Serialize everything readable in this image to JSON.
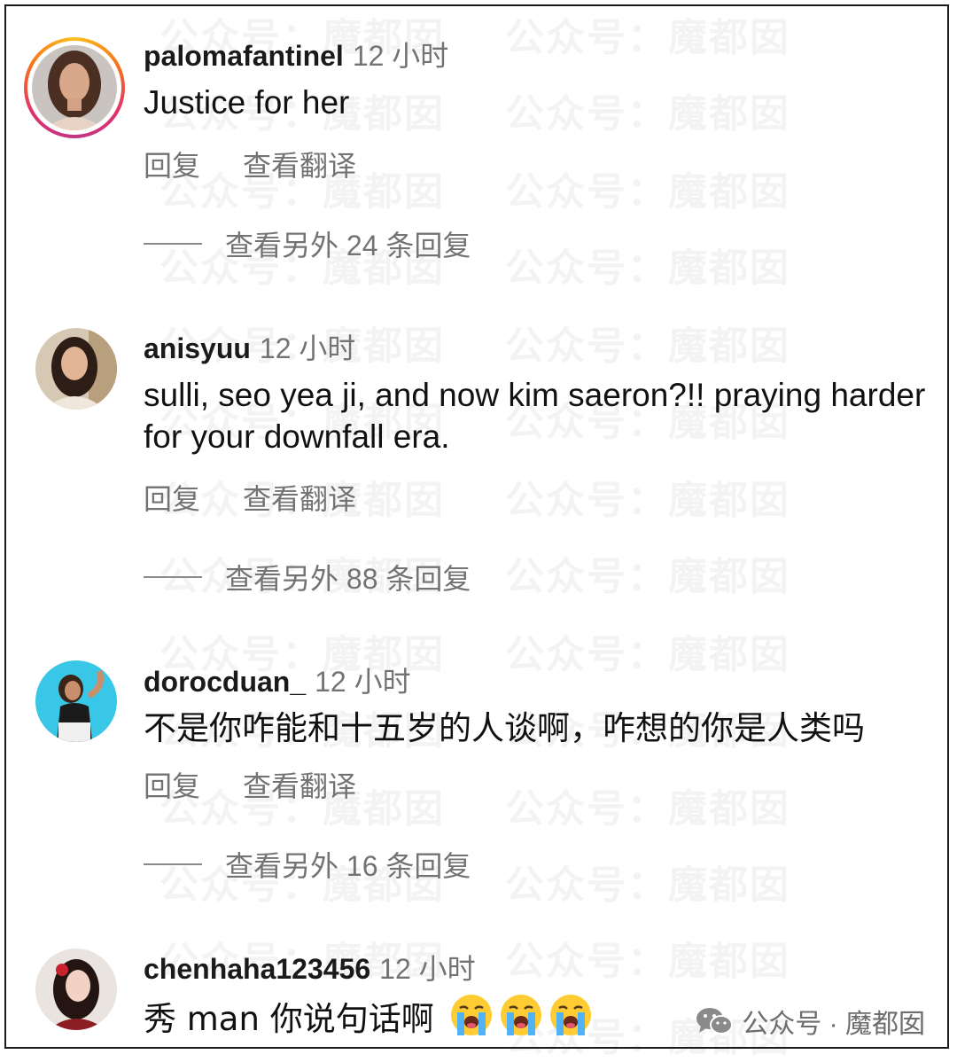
{
  "comments": [
    {
      "username": "palomafantinel",
      "time": "12 小时",
      "text": "Justice for her",
      "reply_label": "回复",
      "translate_label": "查看翻译",
      "more_replies": "查看另外 24 条回复",
      "has_story_ring": true
    },
    {
      "username": "anisyuu",
      "time": "12 小时",
      "text": "sulli, seo yea ji, and now kim saeron?!! praying harder for your downfall era.",
      "reply_label": "回复",
      "translate_label": "查看翻译",
      "more_replies": "查看另外 88 条回复",
      "has_story_ring": false
    },
    {
      "username": "dorocduan_",
      "time": "12 小时",
      "text": "不是你咋能和十五岁的人谈啊，咋想的你是人类吗",
      "reply_label": "回复",
      "translate_label": "查看翻译",
      "more_replies": "查看另外 16 条回复",
      "has_story_ring": false
    },
    {
      "username": "chenhaha123456",
      "time": "12 小时",
      "text": "秀 man 你说句话啊",
      "emojis": [
        "loudly-crying-face",
        "loudly-crying-face",
        "loudly-crying-face"
      ],
      "has_story_ring": false
    }
  ],
  "watermark": {
    "tile_a": "公众号：",
    "tile_b": "魔都囡",
    "footer": "公众号 · 魔都囡",
    "footer_icon": "wechat-icon"
  }
}
